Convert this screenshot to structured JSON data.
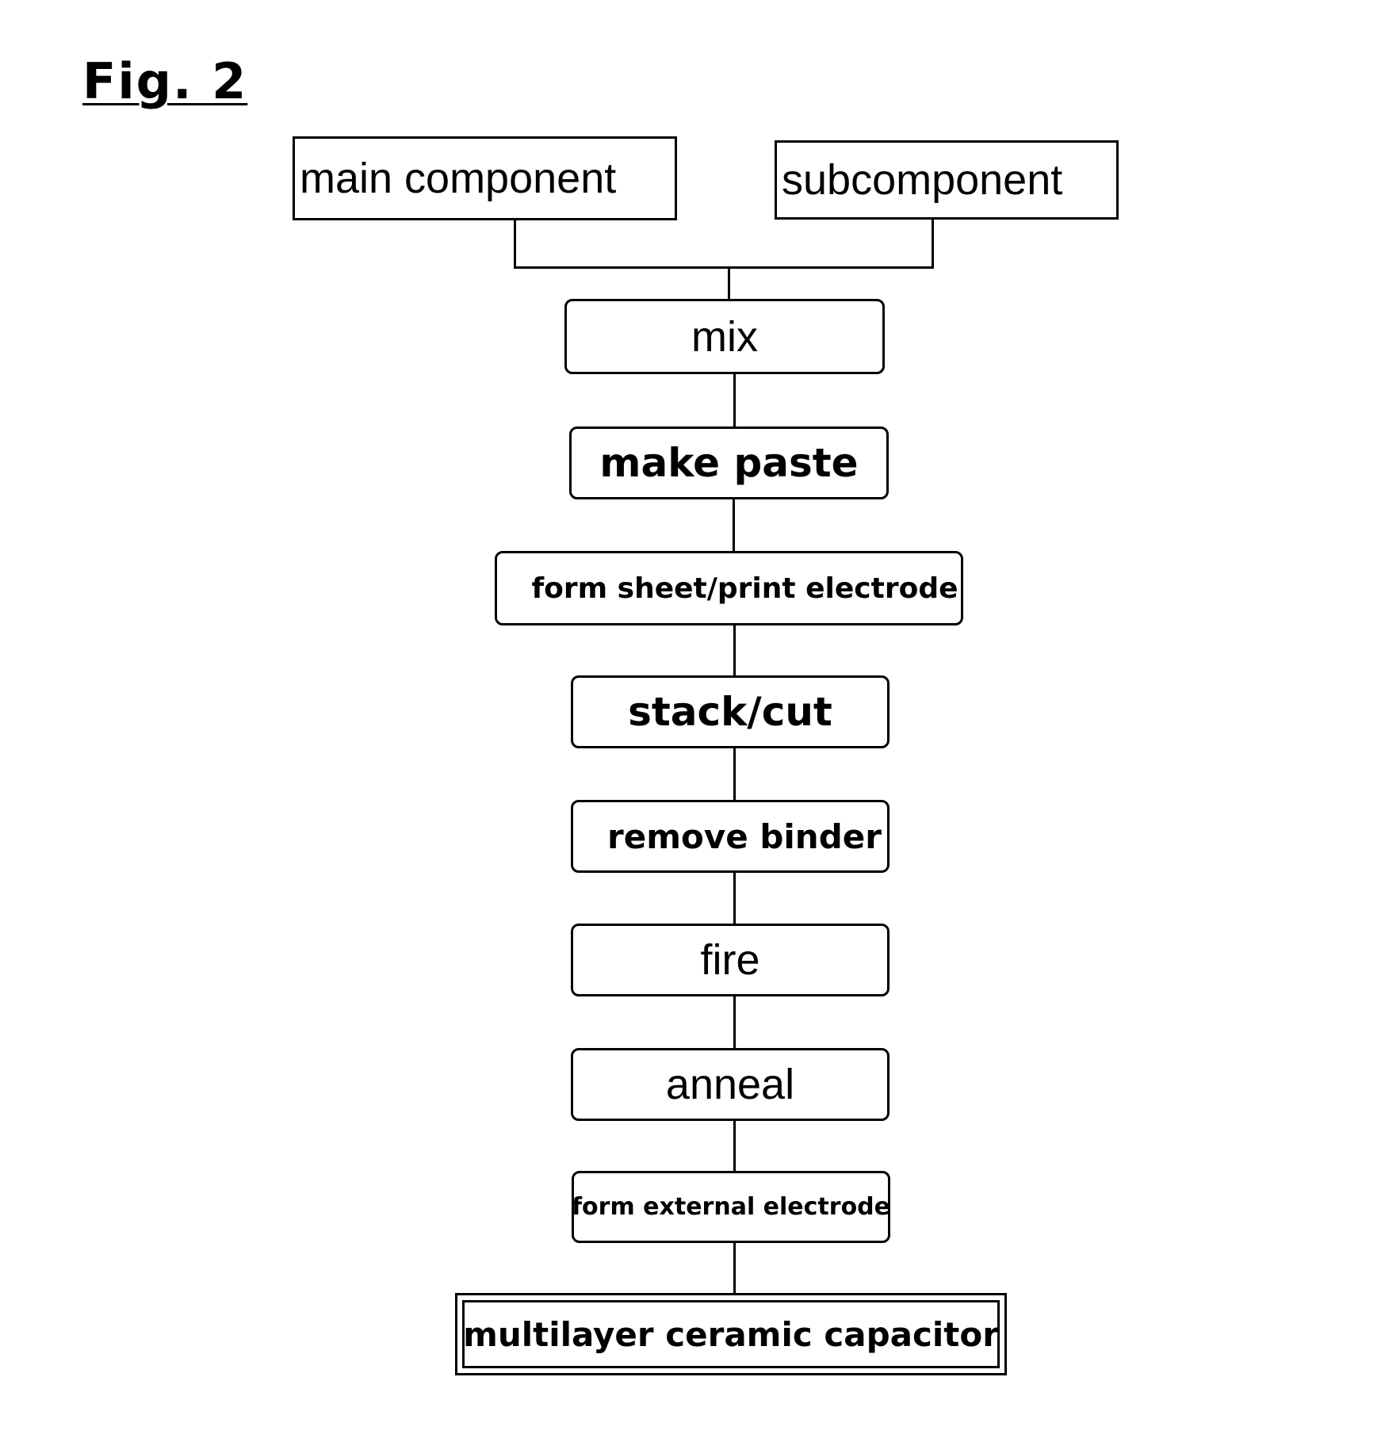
{
  "figure": {
    "title": "Fig. 2"
  },
  "inputs": [
    {
      "id": "main",
      "label": "main component"
    },
    {
      "id": "sub",
      "label": "subcomponent"
    }
  ],
  "steps": [
    {
      "id": "mix",
      "label": "mix"
    },
    {
      "id": "make-paste",
      "label": "make paste"
    },
    {
      "id": "form-sheet",
      "label": "form sheet/print electrode"
    },
    {
      "id": "stack-cut",
      "label": "stack/cut"
    },
    {
      "id": "remove-binder",
      "label": "remove binder"
    },
    {
      "id": "fire",
      "label": "fire"
    },
    {
      "id": "anneal",
      "label": "anneal"
    },
    {
      "id": "form-external",
      "label": "form external electrode"
    }
  ],
  "output": {
    "label": "multilayer ceramic capacitor"
  }
}
